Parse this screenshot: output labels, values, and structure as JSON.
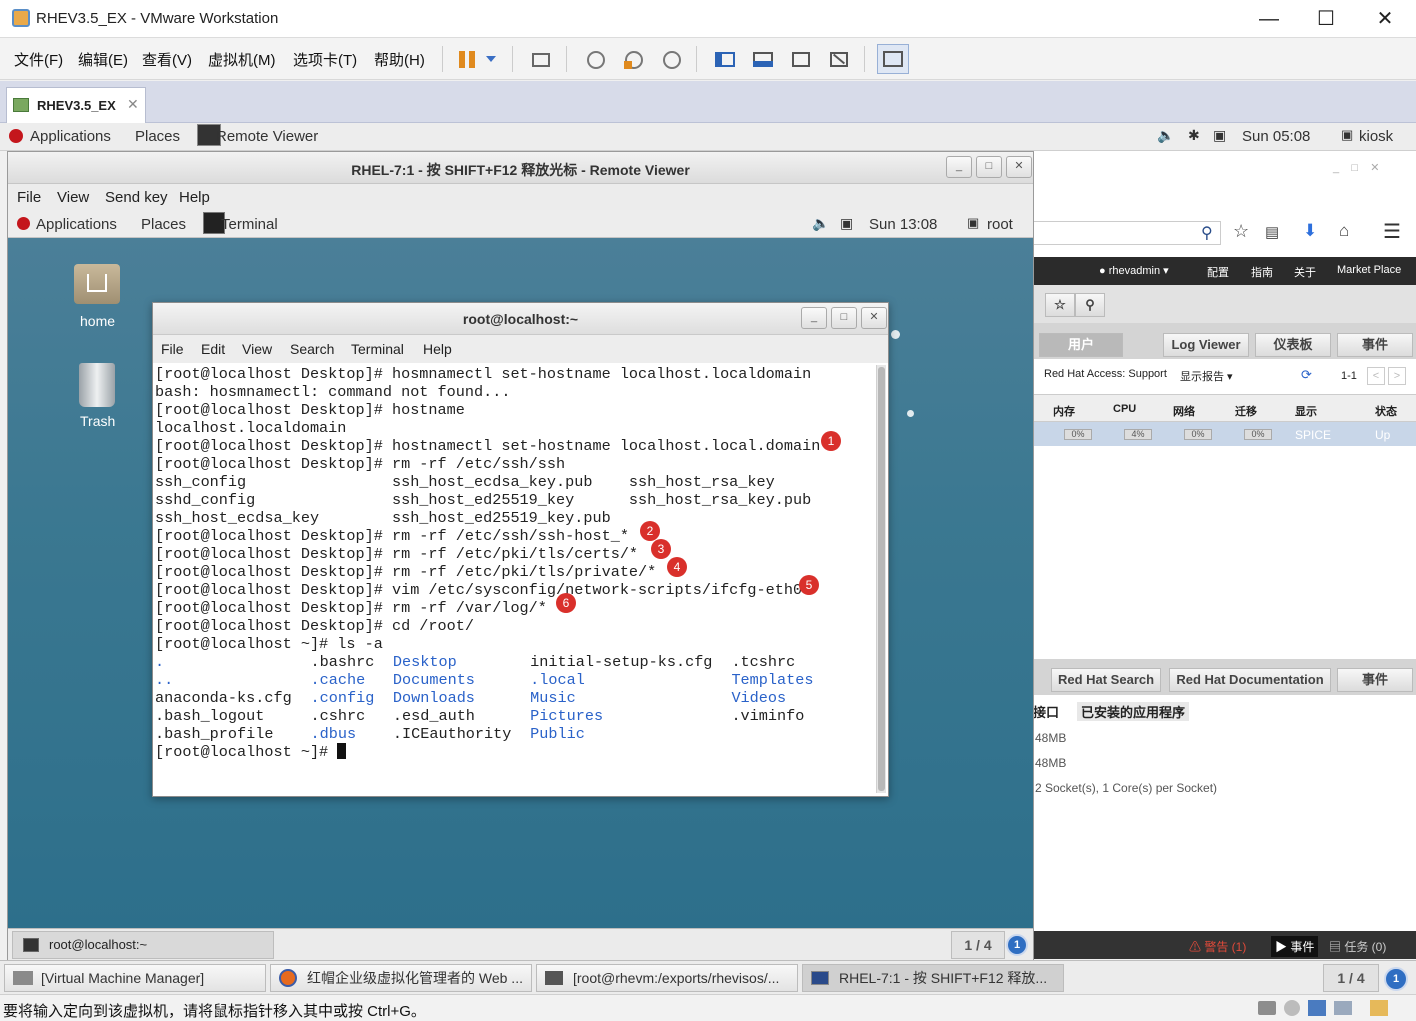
{
  "vmware": {
    "title": "RHEV3.5_EX - VMware Workstation",
    "menus": [
      "文件(F)",
      "编辑(E)",
      "查看(V)",
      "虚拟机(M)",
      "选项卡(T)",
      "帮助(H)"
    ],
    "tab": "RHEV3.5_EX",
    "status": "要将输入定向到该虚拟机，请将鼠标指针移入其中或按 Ctrl+G。"
  },
  "host_panel": {
    "applications": "Applications",
    "places": "Places",
    "app": "Remote Viewer",
    "time": "Sun 05:08",
    "user": "kiosk"
  },
  "viewer": {
    "title": "RHEL-7:1 - 按 SHIFT+F12 释放光标 - Remote Viewer",
    "menus": [
      "File",
      "View",
      "Send key",
      "Help"
    ]
  },
  "guest_panel": {
    "applications": "Applications",
    "places": "Places",
    "app": "Terminal",
    "time": "Sun 13:08",
    "user": "root"
  },
  "desktop": {
    "icons": [
      "home",
      "Trash"
    ]
  },
  "terminal": {
    "title": "root@localhost:~",
    "menus": [
      "File",
      "Edit",
      "View",
      "Search",
      "Terminal",
      "Help"
    ],
    "lines": [
      "[root@localhost Desktop]# hosmnamectl set-hostname localhost.localdomain",
      "bash: hosmnamectl: command not found...",
      "[root@localhost Desktop]# hostname",
      "localhost.localdomain",
      "[root@localhost Desktop]# hostnamectl set-hostname localhost.local.domain",
      "[root@localhost Desktop]# rm -rf /etc/ssh/ssh",
      "ssh_config                ssh_host_ecdsa_key.pub    ssh_host_rsa_key",
      "sshd_config               ssh_host_ed25519_key      ssh_host_rsa_key.pub",
      "ssh_host_ecdsa_key        ssh_host_ed25519_key.pub",
      "[root@localhost Desktop]# rm -rf /etc/ssh/ssh-host_*",
      "[root@localhost Desktop]# rm -rf /etc/pki/tls/certs/*",
      "[root@localhost Desktop]# rm -rf /etc/pki/tls/private/*",
      "[root@localhost Desktop]# vim /etc/sysconfig/network-scripts/ifcfg-eth0",
      "[root@localhost Desktop]# rm -rf /var/log/*",
      "[root@localhost Desktop]# cd /root/",
      "[root@localhost ~]# ls -a"
    ],
    "ls": [
      [
        ".",
        "blue"
      ],
      [
        ".bashrc",
        ""
      ],
      [
        "Desktop",
        "blue"
      ],
      [
        "initial-setup-ks.cfg",
        ""
      ],
      [
        ".tcshrc",
        ""
      ],
      [
        "..",
        "blue"
      ],
      [
        ".cache",
        "blue"
      ],
      [
        "Documents",
        "blue"
      ],
      [
        ".local",
        "blue"
      ],
      [
        "Templates",
        "blue"
      ],
      [
        "anaconda-ks.cfg",
        ""
      ],
      [
        ".config",
        "blue"
      ],
      [
        "Downloads",
        "blue"
      ],
      [
        "Music",
        "blue"
      ],
      [
        "Videos",
        "blue"
      ],
      [
        ".bash_logout",
        ""
      ],
      [
        ".cshrc",
        ""
      ],
      [
        ".esd_auth",
        ""
      ],
      [
        "Pictures",
        "blue"
      ],
      [
        ".viminfo",
        ""
      ],
      [
        ".bash_profile",
        ""
      ],
      [
        ".dbus",
        "blue"
      ],
      [
        ".ICEauthority",
        ""
      ],
      [
        "Public",
        "blue"
      ],
      [
        "",
        ""
      ]
    ],
    "prompt": "[root@localhost ~]# ",
    "badges": [
      "1",
      "2",
      "3",
      "4",
      "5",
      "6"
    ]
  },
  "guest_taskbar": {
    "item": "root@localhost:~",
    "pager": "1 / 4",
    "ws": "1"
  },
  "rhev": {
    "user": "rhevadmin",
    "links": [
      "配置",
      "指南",
      "关于",
      "Market Place"
    ],
    "tabs": [
      "用户",
      "Log Viewer",
      "仪表板",
      "事件"
    ],
    "access": "Red Hat Access: Support",
    "report": "显示报告",
    "paging": "1-1",
    "cols": [
      "内存",
      "CPU",
      "网络",
      "迁移",
      "显示",
      "状态"
    ],
    "row": [
      "0%",
      "4%",
      "0%",
      "0%",
      "SPICE",
      "Up"
    ],
    "bottom_tabs": [
      "Red Hat Search",
      "Red Hat Documentation",
      "事件"
    ],
    "sub_tabs": [
      "接口",
      "已安装的应用程序"
    ],
    "details": [
      "48MB",
      "48MB",
      "2 Socket(s), 1 Core(s) per Socket)"
    ],
    "status": {
      "alerts": "警告 (1)",
      "events": "事件",
      "tasks": "任务 (0)"
    }
  },
  "host_taskbar": {
    "items": [
      "[Virtual Machine Manager]",
      "红帽企业级虚拟化管理者的 Web ...",
      "[root@rhevm:/exports/rhevisos/...",
      "RHEL-7:1 - 按 SHIFT+F12 释放..."
    ],
    "pager": "1 / 4",
    "ws": "1"
  }
}
